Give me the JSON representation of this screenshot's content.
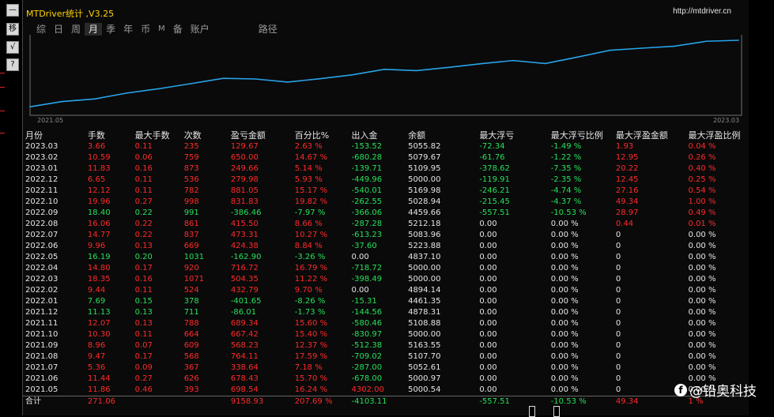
{
  "app": {
    "title": "MTDriver统计 ,V3.25",
    "url": "http://mtdriver.cn"
  },
  "left_toolbar": [
    "—",
    "移",
    "√",
    "?"
  ],
  "tabs": [
    {
      "label": "综",
      "active": false
    },
    {
      "label": "日",
      "active": false
    },
    {
      "label": "周",
      "active": false
    },
    {
      "label": "月",
      "active": true
    },
    {
      "label": "季",
      "active": false
    },
    {
      "label": "年",
      "active": false
    },
    {
      "label": "币",
      "active": false
    },
    {
      "label": "M",
      "active": false
    },
    {
      "label": "备",
      "active": false
    },
    {
      "label": "账户",
      "active": false
    },
    {
      "label": "路径",
      "active": false
    }
  ],
  "chart_data": {
    "type": "line",
    "x_start_label": "2021.05",
    "x_end_label": "2023.03",
    "line_color": "#29a3e8",
    "x": [
      "2021.05",
      "2021.06",
      "2021.07",
      "2021.08",
      "2021.09",
      "2021.10",
      "2021.11",
      "2021.12",
      "2022.01",
      "2022.02",
      "2022.03",
      "2022.04",
      "2022.05",
      "2022.06",
      "2022.07",
      "2022.08",
      "2022.09",
      "2022.10",
      "2022.11",
      "2022.12",
      "2023.01",
      "2023.02",
      "2023.03"
    ],
    "values": [
      698.54,
      1376.97,
      1715.61,
      2479.72,
      3048.03,
      3715.45,
      4404.79,
      4318.78,
      3917.13,
      4349.92,
      4854.27,
      5570.99,
      5408.09,
      5832.47,
      6305.78,
      6721.28,
      6334.82,
      7166.65,
      8047.7,
      8326.68,
      8576.34,
      9226.34,
      9356.01
    ]
  },
  "table": {
    "headers": [
      "月份",
      "手数",
      "最大手数",
      "次数",
      "盈亏金额",
      "百分比%",
      "出入金",
      "余额",
      "最大浮亏",
      "最大浮亏比例",
      "最大浮盈金额",
      "最大浮盈比例"
    ],
    "rows": [
      {
        "c": [
          "2023.03",
          "3.66",
          "0.11",
          "235",
          "129.67",
          "2.63 %",
          "-153.52",
          "5055.82",
          "-72.34",
          "-1.49 %",
          "1.93",
          "0.04 %"
        ],
        "s": [
          "w",
          "r",
          "r",
          "r",
          "r",
          "r",
          "g",
          "w",
          "g",
          "g",
          "r",
          "r"
        ]
      },
      {
        "c": [
          "2023.02",
          "10.59",
          "0.06",
          "759",
          "650.00",
          "14.67 %",
          "-680.28",
          "5079.67",
          "-61.76",
          "-1.22 %",
          "12.95",
          "0.26 %"
        ],
        "s": [
          "w",
          "r",
          "r",
          "r",
          "r",
          "r",
          "g",
          "w",
          "g",
          "g",
          "r",
          "r"
        ]
      },
      {
        "c": [
          "2023.01",
          "11.83",
          "0.16",
          "873",
          "249.66",
          "5.14 %",
          "-139.71",
          "5109.95",
          "-378.62",
          "-7.35 %",
          "20.22",
          "0.40 %"
        ],
        "s": [
          "w",
          "r",
          "r",
          "r",
          "r",
          "r",
          "g",
          "w",
          "g",
          "g",
          "r",
          "r"
        ]
      },
      {
        "c": [
          "2022.12",
          "6.65",
          "0.11",
          "536",
          "279.98",
          "5.93 %",
          "-449.96",
          "5000.00",
          "-119.91",
          "-2.35 %",
          "12.45",
          "0.25 %"
        ],
        "s": [
          "w",
          "r",
          "r",
          "r",
          "r",
          "r",
          "g",
          "w",
          "g",
          "g",
          "r",
          "r"
        ]
      },
      {
        "c": [
          "2022.11",
          "12.12",
          "0.11",
          "782",
          "881.05",
          "15.17 %",
          "-540.01",
          "5169.98",
          "-246.21",
          "-4.74 %",
          "27.16",
          "0.54 %"
        ],
        "s": [
          "w",
          "r",
          "r",
          "r",
          "r",
          "r",
          "g",
          "w",
          "g",
          "g",
          "r",
          "r"
        ]
      },
      {
        "c": [
          "2022.10",
          "19.96",
          "0.27",
          "998",
          "831.83",
          "19.82 %",
          "-262.55",
          "5028.94",
          "-215.45",
          "-4.37 %",
          "49.34",
          "1.00 %"
        ],
        "s": [
          "w",
          "r",
          "r",
          "r",
          "r",
          "r",
          "g",
          "w",
          "g",
          "g",
          "r",
          "r"
        ]
      },
      {
        "c": [
          "2022.09",
          "18.40",
          "0.22",
          "991",
          "-386.46",
          "-7.97 %",
          "-366.06",
          "4459.66",
          "-557.51",
          "-10.53 %",
          "28.97",
          "0.49 %"
        ],
        "s": [
          "w",
          "g",
          "g",
          "g",
          "g",
          "g",
          "g",
          "w",
          "g",
          "g",
          "r",
          "r"
        ]
      },
      {
        "c": [
          "2022.08",
          "16.06",
          "0.22",
          "861",
          "415.50",
          "8.66 %",
          "-287.28",
          "5212.18",
          "0.00",
          "0.00 %",
          "0.44",
          "0.01 %"
        ],
        "s": [
          "w",
          "r",
          "r",
          "r",
          "r",
          "r",
          "g",
          "w",
          "w",
          "w",
          "r",
          "r"
        ]
      },
      {
        "c": [
          "2022.07",
          "14.77",
          "0.22",
          "837",
          "473.31",
          "10.27 %",
          "-613.23",
          "5083.96",
          "0.00",
          "0.00 %",
          "0",
          "0.00 %"
        ],
        "s": [
          "w",
          "r",
          "r",
          "r",
          "r",
          "r",
          "g",
          "w",
          "w",
          "w",
          "w",
          "w"
        ]
      },
      {
        "c": [
          "2022.06",
          "9.96",
          "0.13",
          "669",
          "424.38",
          "8.84 %",
          "-37.60",
          "5223.88",
          "0.00",
          "0.00 %",
          "0",
          "0.00 %"
        ],
        "s": [
          "w",
          "r",
          "r",
          "r",
          "r",
          "r",
          "g",
          "w",
          "w",
          "w",
          "w",
          "w"
        ]
      },
      {
        "c": [
          "2022.05",
          "16.19",
          "0.20",
          "1031",
          "-162.90",
          "-3.26 %",
          "0.00",
          "4837.10",
          "0.00",
          "0.00 %",
          "0",
          "0.00 %"
        ],
        "s": [
          "w",
          "g",
          "g",
          "g",
          "g",
          "g",
          "w",
          "w",
          "w",
          "w",
          "w",
          "w"
        ]
      },
      {
        "c": [
          "2022.04",
          "14.80",
          "0.17",
          "920",
          "716.72",
          "16.79 %",
          "-718.72",
          "5000.00",
          "0.00",
          "0.00 %",
          "0",
          "0.00 %"
        ],
        "s": [
          "w",
          "r",
          "r",
          "r",
          "r",
          "r",
          "g",
          "w",
          "w",
          "w",
          "w",
          "w"
        ]
      },
      {
        "c": [
          "2022.03",
          "18.35",
          "0.16",
          "1071",
          "504.35",
          "11.22 %",
          "-398.49",
          "5000.00",
          "0.00",
          "0.00 %",
          "0",
          "0.00 %"
        ],
        "s": [
          "w",
          "r",
          "r",
          "r",
          "r",
          "r",
          "g",
          "w",
          "w",
          "w",
          "w",
          "w"
        ]
      },
      {
        "c": [
          "2022.02",
          "9.44",
          "0.11",
          "524",
          "432.79",
          "9.70 %",
          "0.00",
          "4894.14",
          "0.00",
          "0.00 %",
          "0",
          "0.00 %"
        ],
        "s": [
          "w",
          "r",
          "r",
          "r",
          "r",
          "r",
          "w",
          "w",
          "w",
          "w",
          "w",
          "w"
        ]
      },
      {
        "c": [
          "2022.01",
          "7.69",
          "0.15",
          "378",
          "-401.65",
          "-8.26 %",
          "-15.31",
          "4461.35",
          "0.00",
          "0.00 %",
          "0",
          "0.00 %"
        ],
        "s": [
          "w",
          "g",
          "g",
          "g",
          "g",
          "g",
          "g",
          "w",
          "w",
          "w",
          "w",
          "w"
        ]
      },
      {
        "c": [
          "2021.12",
          "11.13",
          "0.13",
          "711",
          "-86.01",
          "-1.73 %",
          "-144.56",
          "4878.31",
          "0.00",
          "0.00 %",
          "0",
          "0.00 %"
        ],
        "s": [
          "w",
          "g",
          "g",
          "g",
          "g",
          "g",
          "g",
          "w",
          "w",
          "w",
          "w",
          "w"
        ]
      },
      {
        "c": [
          "2021.11",
          "12.07",
          "0.13",
          "788",
          "689.34",
          "15.60 %",
          "-580.46",
          "5108.88",
          "0.00",
          "0.00 %",
          "0",
          "0.00 %"
        ],
        "s": [
          "w",
          "r",
          "r",
          "r",
          "r",
          "r",
          "g",
          "w",
          "w",
          "w",
          "w",
          "w"
        ]
      },
      {
        "c": [
          "2021.10",
          "10.30",
          "0.11",
          "664",
          "667.42",
          "15.40 %",
          "-830.97",
          "5000.00",
          "0.00",
          "0.00 %",
          "0",
          "0.00 %"
        ],
        "s": [
          "w",
          "r",
          "r",
          "r",
          "r",
          "r",
          "g",
          "w",
          "w",
          "w",
          "w",
          "w"
        ]
      },
      {
        "c": [
          "2021.09",
          "8.96",
          "0.07",
          "609",
          "568.23",
          "12.37 %",
          "-512.38",
          "5163.55",
          "0.00",
          "0.00 %",
          "0",
          "0.00 %"
        ],
        "s": [
          "w",
          "r",
          "r",
          "r",
          "r",
          "r",
          "g",
          "w",
          "w",
          "w",
          "w",
          "w"
        ]
      },
      {
        "c": [
          "2021.08",
          "9.47",
          "0.17",
          "568",
          "764.11",
          "17.59 %",
          "-709.02",
          "5107.70",
          "0.00",
          "0.00 %",
          "0",
          "0.00 %"
        ],
        "s": [
          "w",
          "r",
          "r",
          "r",
          "r",
          "r",
          "g",
          "w",
          "w",
          "w",
          "w",
          "w"
        ]
      },
      {
        "c": [
          "2021.07",
          "5.36",
          "0.09",
          "367",
          "338.64",
          "7.18 %",
          "-287.00",
          "5052.61",
          "0.00",
          "0.00 %",
          "0",
          "0.00 %"
        ],
        "s": [
          "w",
          "r",
          "r",
          "r",
          "r",
          "r",
          "g",
          "w",
          "w",
          "w",
          "w",
          "w"
        ]
      },
      {
        "c": [
          "2021.06",
          "11.44",
          "0.27",
          "626",
          "678.43",
          "15.70 %",
          "-678.00",
          "5000.97",
          "0.00",
          "0.00 %",
          "0",
          "0.00 %"
        ],
        "s": [
          "w",
          "r",
          "r",
          "r",
          "r",
          "r",
          "g",
          "w",
          "w",
          "w",
          "w",
          "w"
        ]
      },
      {
        "c": [
          "2021.05",
          "11.86",
          "0.46",
          "393",
          "698.54",
          "16.24 %",
          "4302.00",
          "5000.54",
          "0.00",
          "0.00 %",
          "0",
          "0.00 %"
        ],
        "s": [
          "w",
          "r",
          "r",
          "r",
          "r",
          "r",
          "r",
          "w",
          "w",
          "w",
          "w",
          "w"
        ]
      }
    ],
    "total": {
      "c": [
        "合计",
        "271.06",
        "",
        "",
        "9158.93",
        "207.69 %",
        "-4103.11",
        "",
        "-557.51",
        "-10.53 %",
        "49.34",
        "1 %"
      ],
      "s": [
        "w",
        "r",
        "r",
        "r",
        "r",
        "r",
        "g",
        "w",
        "g",
        "g",
        "r",
        "r"
      ]
    }
  },
  "watermark": {
    "icon": "f",
    "text": "@铅奥科技"
  }
}
